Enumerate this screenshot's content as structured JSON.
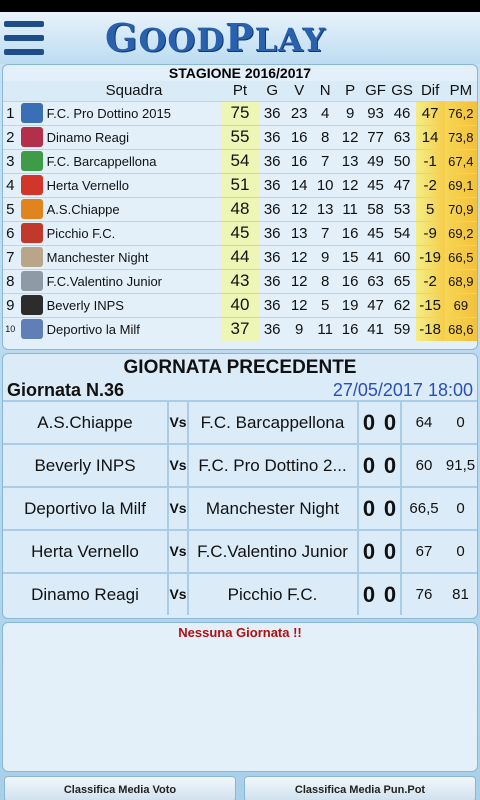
{
  "header": {
    "logo_part1": "G",
    "logo_part2": "OOD",
    "logo_part3": "P",
    "logo_part4": "LAY"
  },
  "standings": {
    "season": "STAGIONE 2016/2017",
    "columns": [
      "Squadra",
      "Pt",
      "G",
      "V",
      "N",
      "P",
      "GF",
      "GS",
      "Dif",
      "PM"
    ],
    "rows": [
      {
        "rank": "1",
        "team": "F.C. Pro Dottino 2015",
        "pt": "75",
        "g": "36",
        "v": "23",
        "n": "4",
        "p": "9",
        "gf": "93",
        "gs": "46",
        "dif": "47",
        "pm": "76,2",
        "logo_color": "#3b6fb5"
      },
      {
        "rank": "2",
        "team": "Dinamo Reagi",
        "pt": "55",
        "g": "36",
        "v": "16",
        "n": "8",
        "p": "12",
        "gf": "77",
        "gs": "63",
        "dif": "14",
        "pm": "73,8",
        "logo_color": "#b4304a"
      },
      {
        "rank": "3",
        "team": "F.C. Barcappellona",
        "pt": "54",
        "g": "36",
        "v": "16",
        "n": "7",
        "p": "13",
        "gf": "49",
        "gs": "50",
        "dif": "-1",
        "pm": "67,4",
        "logo_color": "#3e9b47"
      },
      {
        "rank": "4",
        "team": "Herta Vernello",
        "pt": "51",
        "g": "36",
        "v": "14",
        "n": "10",
        "p": "12",
        "gf": "45",
        "gs": "47",
        "dif": "-2",
        "pm": "69,1",
        "logo_color": "#d2352a"
      },
      {
        "rank": "5",
        "team": "A.S.Chiappe",
        "pt": "48",
        "g": "36",
        "v": "12",
        "n": "13",
        "p": "11",
        "gf": "58",
        "gs": "53",
        "dif": "5",
        "pm": "70,9",
        "logo_color": "#e0851d"
      },
      {
        "rank": "6",
        "team": "Picchio F.C.",
        "pt": "45",
        "g": "36",
        "v": "13",
        "n": "7",
        "p": "16",
        "gf": "45",
        "gs": "54",
        "dif": "-9",
        "pm": "69,2",
        "logo_color": "#c0392b"
      },
      {
        "rank": "7",
        "team": "Manchester Night",
        "pt": "44",
        "g": "36",
        "v": "12",
        "n": "9",
        "p": "15",
        "gf": "41",
        "gs": "60",
        "dif": "-19",
        "pm": "66,5",
        "logo_color": "#b9a58a"
      },
      {
        "rank": "8",
        "team": "F.C.Valentino Junior",
        "pt": "43",
        "g": "36",
        "v": "12",
        "n": "8",
        "p": "16",
        "gf": "63",
        "gs": "65",
        "dif": "-2",
        "pm": "68,9",
        "logo_color": "#8e9aa6"
      },
      {
        "rank": "9",
        "team": "Beverly INPS",
        "pt": "40",
        "g": "36",
        "v": "12",
        "n": "5",
        "p": "19",
        "gf": "47",
        "gs": "62",
        "dif": "-15",
        "pm": "69",
        "logo_color": "#2c2c2c"
      },
      {
        "rank": "10",
        "team": "Deportivo la Milf",
        "pt": "37",
        "g": "36",
        "v": "9",
        "n": "11",
        "p": "16",
        "gf": "41",
        "gs": "59",
        "dif": "-18",
        "pm": "68,6",
        "logo_color": "#5f7fb6"
      }
    ]
  },
  "previous_round": {
    "title": "GIORNATA PRECEDENTE",
    "round_label": "Giornata N.36",
    "date": "27/05/2017 18:00",
    "vs_label": "Vs",
    "matches": [
      {
        "home": "A.S.Chiappe",
        "away": "F.C. Barcappellona",
        "goals_home": "0",
        "goals_away": "0",
        "pts_home": "64",
        "pts_away": "0"
      },
      {
        "home": "Beverly INPS",
        "away": "F.C. Pro Dottino 2...",
        "goals_home": "0",
        "goals_away": "0",
        "pts_home": "60",
        "pts_away": "91,5"
      },
      {
        "home": "Deportivo la Milf",
        "away": "Manchester Night",
        "goals_home": "0",
        "goals_away": "0",
        "pts_home": "66,5",
        "pts_away": "0"
      },
      {
        "home": "Herta Vernello",
        "away": "F.C.Valentino Junior",
        "goals_home": "0",
        "goals_away": "0",
        "pts_home": "67",
        "pts_away": "0"
      },
      {
        "home": "Dinamo Reagi",
        "away": "Picchio F.C.",
        "goals_home": "0",
        "goals_away": "0",
        "pts_home": "76",
        "pts_away": "81"
      }
    ]
  },
  "next_round": {
    "message": "Nessuna Giornata !!"
  },
  "bottom": {
    "media_voto": "Classifica Media Voto",
    "media_pun": "Classifica Media Pun.Pot"
  }
}
